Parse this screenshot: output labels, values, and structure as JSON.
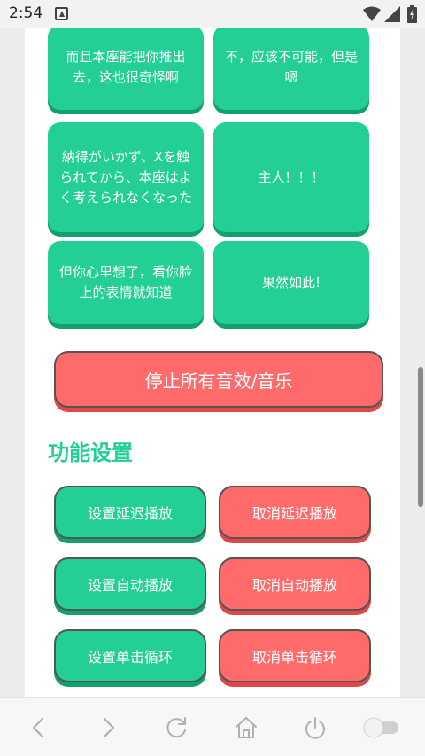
{
  "status_bar": {
    "time": "2:54"
  },
  "sound_buttons": [
    {
      "label": "而且本座能把你推出去，这也很奇怪啊"
    },
    {
      "label": "不，应该不可能，但是嗯"
    },
    {
      "label": "納得がいかず、Xを触られてから、本座はよく考えられなくなった"
    },
    {
      "label": "主人！！！"
    },
    {
      "label": "但你心里想了，看你脸上的表情就知道"
    },
    {
      "label": "果然如此!"
    }
  ],
  "stop_button": {
    "label": "停止所有音效/音乐"
  },
  "settings": {
    "title": "功能设置",
    "buttons": [
      {
        "label": "设置延迟播放"
      },
      {
        "label": "取消延迟播放"
      },
      {
        "label": "设置自动播放"
      },
      {
        "label": "取消自动播放"
      },
      {
        "label": "设置单击循环"
      },
      {
        "label": "取消单击循环"
      }
    ]
  },
  "colors": {
    "accent": "#23cf95",
    "danger": "#ff6b6b"
  },
  "nav_icons": [
    "back-icon",
    "forward-icon",
    "refresh-icon",
    "home-icon",
    "power-icon",
    "toggle-switch"
  ]
}
